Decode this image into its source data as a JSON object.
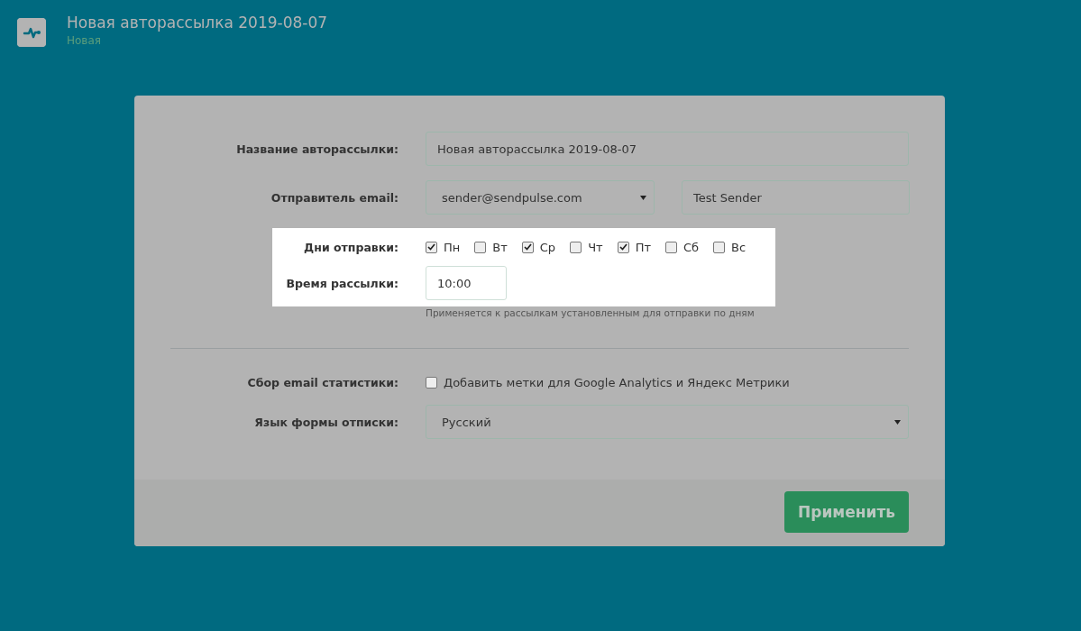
{
  "header": {
    "title": "Новая авторассылка 2019-08-07",
    "status": "Новая"
  },
  "form": {
    "sections": [
      {
        "spotlight": false,
        "divider_before": false,
        "rows": [
          {
            "kind": "text",
            "label": "Название авторассылки:",
            "value": "Новая авторассылка 2019-08-07"
          },
          {
            "kind": "sender",
            "label": "Отправитель email:",
            "email": "sender@sendpulse.com",
            "name": "Test Sender"
          }
        ]
      },
      {
        "spotlight": true,
        "divider_before": false,
        "rows": [
          {
            "kind": "days",
            "label": "Дни отправки:",
            "days": [
              {
                "label": "Пн",
                "checked": true
              },
              {
                "label": "Вт",
                "checked": false
              },
              {
                "label": "Ср",
                "checked": true
              },
              {
                "label": "Чт",
                "checked": false
              },
              {
                "label": "Пт",
                "checked": true
              },
              {
                "label": "Сб",
                "checked": false
              },
              {
                "label": "Вс",
                "checked": false
              }
            ]
          },
          {
            "kind": "time",
            "label": "Время рассылки:",
            "value": "10:00"
          }
        ]
      },
      {
        "spotlight": false,
        "divider_before": false,
        "rows": [
          {
            "kind": "hint",
            "text": "Применяется к рассылкам установленным для отправки по дням"
          }
        ]
      },
      {
        "spotlight": false,
        "divider_before": true,
        "rows": [
          {
            "kind": "check",
            "label": "Сбор email статистики:",
            "text": "Добавить метки для Google Analytics и Яндекс Метрики",
            "checked": false
          },
          {
            "kind": "select",
            "label": "Язык формы отписки:",
            "value": "Русский"
          }
        ]
      }
    ],
    "submit": "Применить"
  }
}
